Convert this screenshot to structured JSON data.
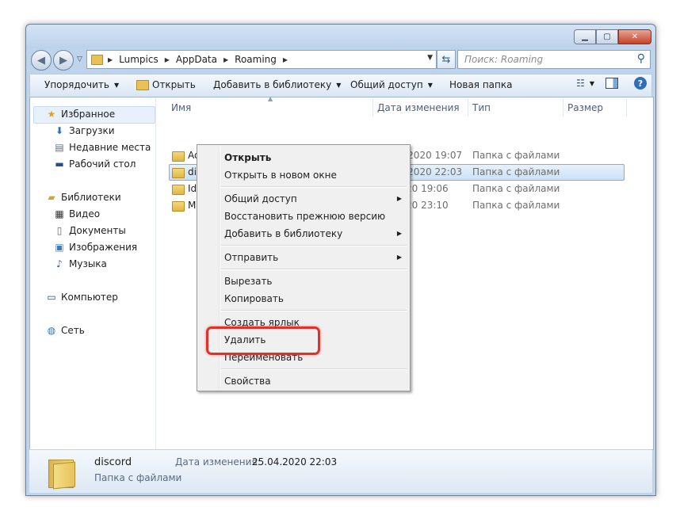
{
  "window": {
    "caption_buttons": [
      "minimize-icon",
      "maximize-icon",
      "close-icon"
    ]
  },
  "address_bar": {
    "crumbs": [
      "Lumpics",
      "AppData",
      "Roaming"
    ],
    "search_placeholder": "Поиск: Roaming"
  },
  "toolbar": {
    "organize": "Упорядочить",
    "open": "Открыть",
    "add_to_library": "Добавить в библиотеку",
    "share": "Общий доступ",
    "new_folder": "Новая папка"
  },
  "sidebar": {
    "favorites": "Избранное",
    "favorites_items": [
      "Загрузки",
      "Недавние места",
      "Рабочий стол"
    ],
    "libraries": "Библиотеки",
    "libraries_items": [
      "Видео",
      "Документы",
      "Изображения",
      "Музыка"
    ],
    "computer": "Компьютер",
    "network": "Сеть"
  },
  "columns": {
    "name": "Имя",
    "date": "Дата изменения",
    "type": "Тип",
    "size": "Размер"
  },
  "files": [
    {
      "name": "Adobe",
      "date": "22.04.2020 19:07",
      "type": "Папка с файлами"
    },
    {
      "name": "discord",
      "name_visible": "dis",
      "date": "25.04.2020 22:03",
      "type": "Папка с файлами"
    },
    {
      "name_visible": "Ide",
      "date_visible": "20 19:06",
      "type": "Папка с файлами"
    },
    {
      "name_visible": "Mi",
      "date_visible": "20 23:10",
      "type": "Папка с файлами"
    }
  ],
  "context_menu": {
    "open": "Открыть",
    "open_new_window": "Открыть в новом окне",
    "share": "Общий доступ",
    "restore_previous": "Восстановить прежнюю версию",
    "add_to_library": "Добавить в библиотеку",
    "send_to": "Отправить",
    "cut": "Вырезать",
    "copy": "Копировать",
    "create_shortcut": "Создать ярлык",
    "delete": "Удалить",
    "rename": "Переименовать",
    "properties": "Свойства"
  },
  "details_pane": {
    "name": "discord",
    "type": "Папка с файлами",
    "date_label": "Дата изменения:",
    "date_value": "25.04.2020 22:03"
  },
  "colors": {
    "highlight_ring": "#e2302a",
    "selection": "#cce1f7"
  }
}
